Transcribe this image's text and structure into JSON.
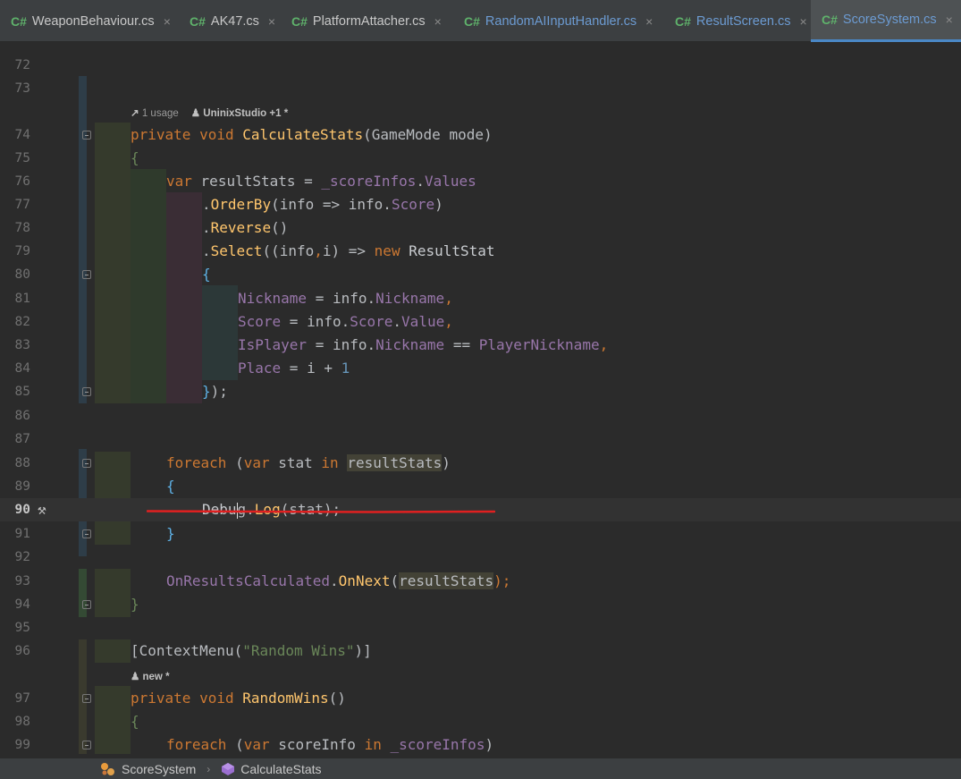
{
  "tabs": [
    {
      "badge": "C#",
      "label": "WeaponBehaviour.cs",
      "close": "×"
    },
    {
      "badge": "C#",
      "label": "AK47.cs",
      "close": "×"
    },
    {
      "badge": "C#",
      "label": "PlatformAttacher.cs",
      "close": "×"
    },
    {
      "badge": "C#",
      "label": "RandomAIInputHandler.cs",
      "close": "×"
    },
    {
      "badge": "C#",
      "label": "ResultScreen.cs",
      "close": "×"
    },
    {
      "badge": "C#",
      "label": "ScoreSystem.cs",
      "close": "×"
    }
  ],
  "active_tab": "ScoreSystem.cs",
  "line_numbers": [
    "72",
    "73",
    "74",
    "75",
    "76",
    "77",
    "78",
    "79",
    "80",
    "81",
    "82",
    "83",
    "84",
    "85",
    "86",
    "87",
    "88",
    "89",
    "90",
    "91",
    "92",
    "93",
    "94",
    "95",
    "96",
    "97",
    "98",
    "99"
  ],
  "hints": {
    "usage": "1 usage",
    "author": "UninixStudio +1 *",
    "new": "new *"
  },
  "code": {
    "l74": [
      "private",
      "void",
      "CalculateStats",
      "(GameMode mode)"
    ],
    "l75": "{",
    "l76": [
      "var",
      "resultStats = ",
      "_scoreInfos",
      ".",
      "Values"
    ],
    "l77": [
      ".",
      "OrderBy",
      "(info => info.",
      "Score",
      ")"
    ],
    "l78": [
      ".",
      "Reverse",
      "()"
    ],
    "l79": [
      ".",
      "Select",
      "((info",
      ",",
      "i) => ",
      "new",
      " ResultStat"
    ],
    "l80": "{",
    "l81": [
      "Nickname",
      " = info.",
      "Nickname",
      ","
    ],
    "l82": [
      "Score",
      " = info.",
      "Score",
      ".",
      "Value",
      ","
    ],
    "l83": [
      "IsPlayer",
      " = info.",
      "Nickname",
      " == ",
      "PlayerNickname",
      ","
    ],
    "l84": [
      "Place",
      " = i + ",
      "1"
    ],
    "l85": [
      "}",
      ");"
    ],
    "l88": [
      "foreach",
      " (",
      "var",
      " stat ",
      "in",
      " ",
      "resultStats",
      ")"
    ],
    "l89": "{",
    "l90": [
      "Debu",
      "g.",
      "Log",
      "(stat);"
    ],
    "l91": "}",
    "l93": [
      "OnResultsCalculated",
      ".",
      "OnNext",
      "(",
      "resultStats",
      ");"
    ],
    "l94": "}",
    "l96": [
      "[ContextMenu(",
      "\"Random Wins\"",
      ")]"
    ],
    "l97": [
      "private",
      "void",
      "RandomWins",
      "()"
    ],
    "l98": "{",
    "l99": [
      "foreach",
      " (",
      "var",
      " scoreInfo ",
      "in",
      " ",
      "_scoreInfos",
      ")"
    ]
  },
  "breadcrumb": {
    "class_name": "ScoreSystem",
    "separator": "›",
    "method_name": "CalculateStats"
  },
  "colors": {
    "keyword": "#cc7832",
    "method": "#ffc66d",
    "property": "#9876aa",
    "string": "#6a8759",
    "number": "#6897bb",
    "annotation_underline": "#e02020"
  },
  "icons": [
    "hammer-icon",
    "fold-icon",
    "class-icon",
    "method-icon",
    "usage-icon",
    "author-icon",
    "close-icon"
  ]
}
